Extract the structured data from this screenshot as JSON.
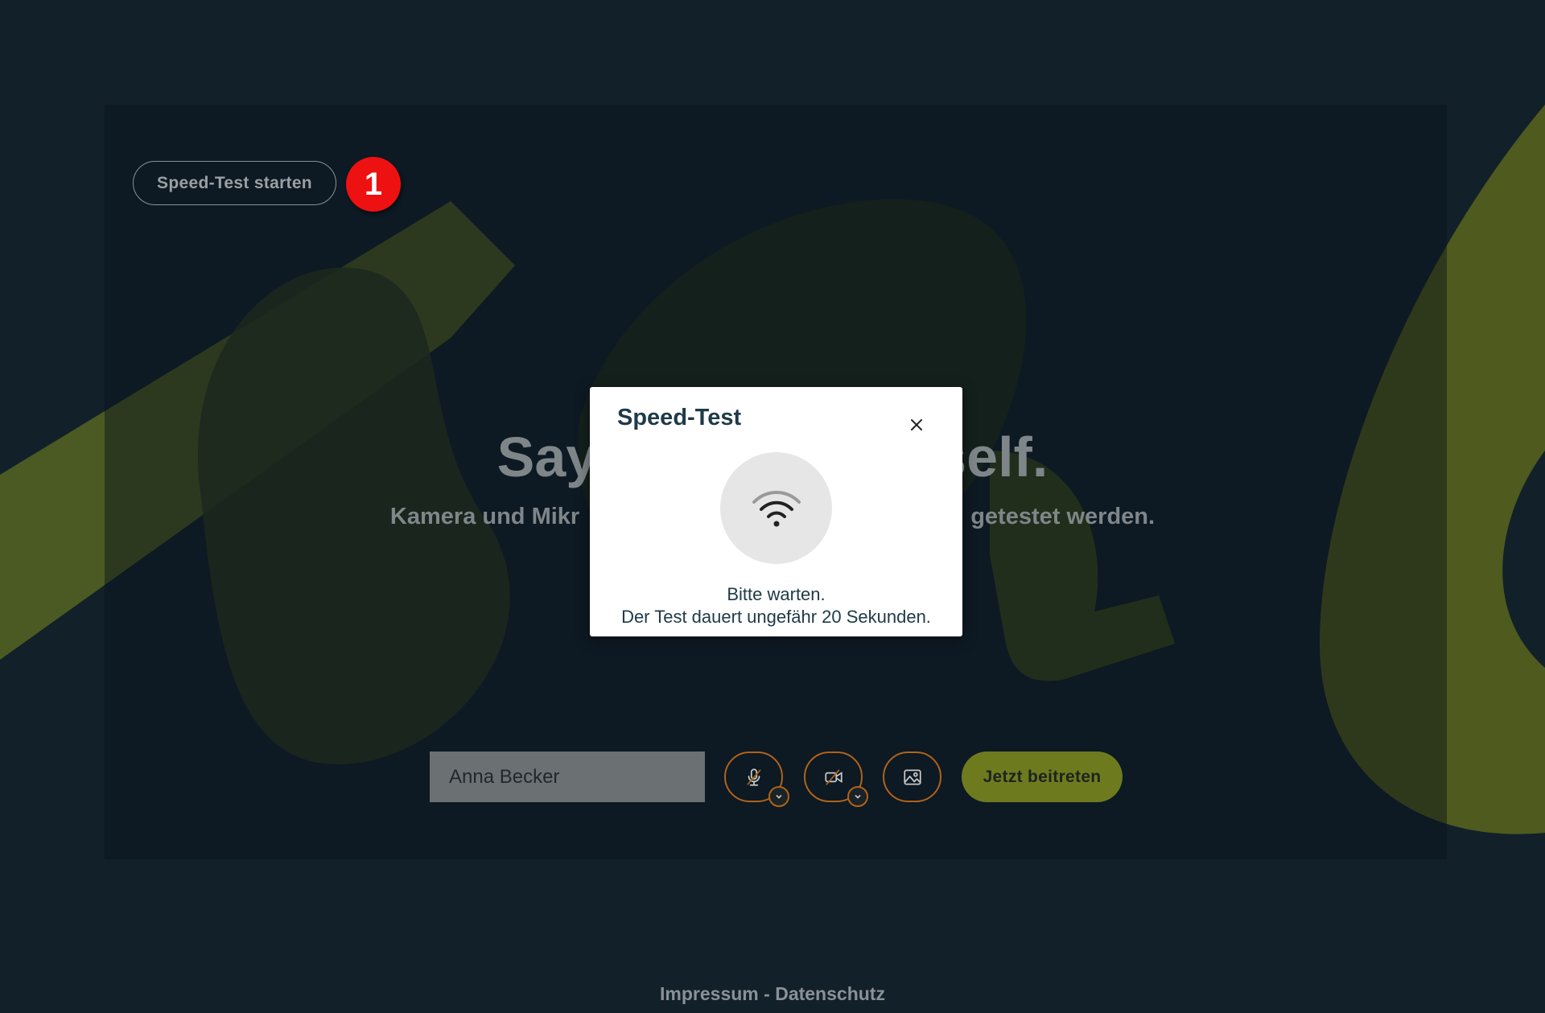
{
  "colors": {
    "background": "#12202a",
    "accent_green": "#6e7a1e",
    "accent_orange": "#b0631a",
    "badge_red": "#ee1111",
    "modal_text": "#1f3a48"
  },
  "toolbar": {
    "speedtest_label": "Speed-Test starten",
    "step_badge": "1"
  },
  "hero": {
    "title_left": "Say",
    "title_right": "self.",
    "subtitle_left": "Kamera und Mikr",
    "subtitle_right": "getestet werden."
  },
  "controls": {
    "name_value": "Anna Becker",
    "mic_icon": "mic-muted-icon",
    "camera_icon": "camera-off-icon",
    "background_icon": "image-icon",
    "join_label": "Jetzt beitreten"
  },
  "footer": {
    "impressum": "Impressum",
    "separator": " - ",
    "datenschutz": "Datenschutz"
  },
  "modal": {
    "title": "Speed-Test",
    "icon": "wifi-icon",
    "close_icon": "close-icon",
    "line1": "Bitte warten.",
    "line2": "Der Test dauert ungefähr 20 Sekunden."
  }
}
